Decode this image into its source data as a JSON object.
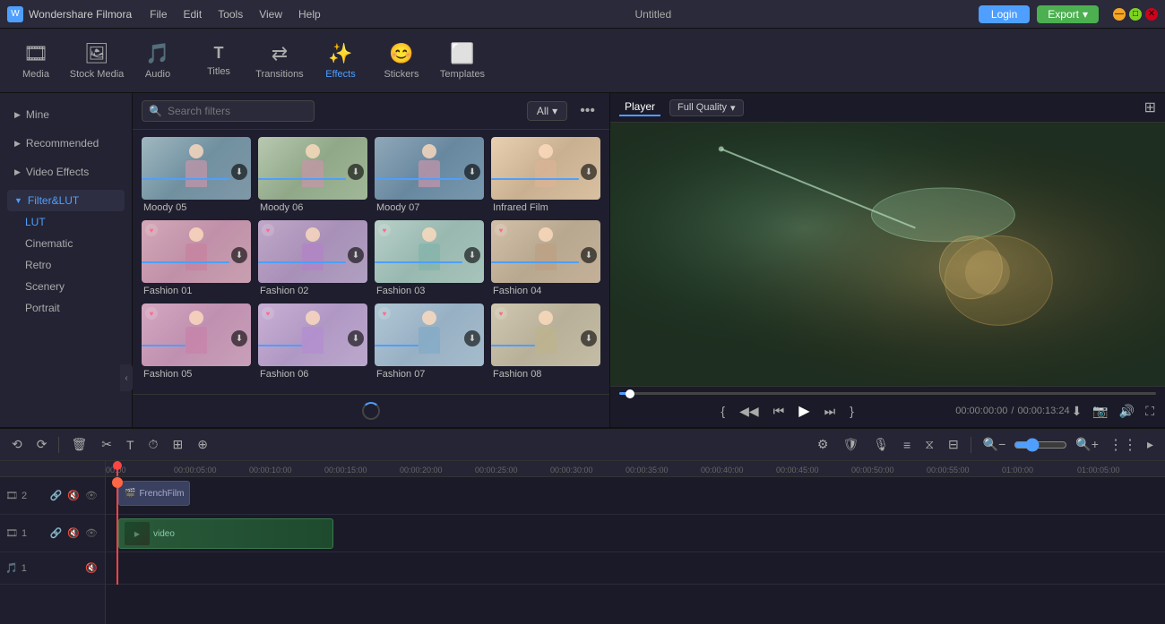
{
  "titlebar": {
    "app_name": "Wondershare Filmora",
    "logo_text": "W",
    "menus": [
      "File",
      "Edit",
      "Tools",
      "View",
      "Help"
    ],
    "title": "Untitled",
    "login_label": "Login",
    "export_label": "Export"
  },
  "toolbar": {
    "items": [
      {
        "id": "media",
        "label": "Media",
        "icon": "🎞"
      },
      {
        "id": "stock-media",
        "label": "Stock Media",
        "icon": "🖼"
      },
      {
        "id": "audio",
        "label": "Audio",
        "icon": "🎵"
      },
      {
        "id": "titles",
        "label": "Titles",
        "icon": "T"
      },
      {
        "id": "transitions",
        "label": "Transitions",
        "icon": "↔"
      },
      {
        "id": "effects",
        "label": "Effects",
        "icon": "✨"
      },
      {
        "id": "stickers",
        "label": "Stickers",
        "icon": "😊"
      },
      {
        "id": "templates",
        "label": "Templates",
        "icon": "⬜"
      }
    ]
  },
  "sidebar": {
    "sections": [
      {
        "id": "mine",
        "label": "Mine",
        "expanded": false
      },
      {
        "id": "recommended",
        "label": "Recommended",
        "expanded": false
      },
      {
        "id": "video-effects",
        "label": "Video Effects",
        "expanded": false
      },
      {
        "id": "filter-lut",
        "label": "Filter&LUT",
        "expanded": true
      }
    ],
    "subsections": [
      {
        "id": "lut",
        "label": "LUT",
        "active": true
      },
      {
        "id": "cinematic",
        "label": "Cinematic"
      },
      {
        "id": "retro",
        "label": "Retro"
      },
      {
        "id": "scenery",
        "label": "Scenery"
      },
      {
        "id": "portrait",
        "label": "Portrait"
      }
    ]
  },
  "filter_panel": {
    "search_placeholder": "Search filters",
    "all_label": "All",
    "filters": [
      {
        "id": "moody05",
        "label": "Moody 05",
        "thumb_class": "moody05",
        "has_download": true,
        "has_heart": false,
        "progress": 80
      },
      {
        "id": "moody06",
        "label": "Moody 06",
        "thumb_class": "moody06",
        "has_download": true,
        "has_heart": false,
        "progress": 80
      },
      {
        "id": "moody07",
        "label": "Moody 07",
        "thumb_class": "moody07",
        "has_download": true,
        "has_heart": false,
        "progress": 80
      },
      {
        "id": "infrared",
        "label": "Infrared Film",
        "thumb_class": "infrared",
        "has_download": true,
        "has_heart": false,
        "progress": 80
      },
      {
        "id": "fashion01",
        "label": "Fashion 01",
        "thumb_class": "fashion01",
        "has_download": true,
        "has_heart": true,
        "progress": 80
      },
      {
        "id": "fashion02",
        "label": "Fashion 02",
        "thumb_class": "fashion02",
        "has_download": true,
        "has_heart": true,
        "progress": 80
      },
      {
        "id": "fashion03",
        "label": "Fashion 03",
        "thumb_class": "fashion03",
        "has_download": true,
        "has_heart": true,
        "progress": 80
      },
      {
        "id": "fashion04",
        "label": "Fashion 04",
        "thumb_class": "fashion04",
        "has_download": true,
        "has_heart": true,
        "progress": 80
      },
      {
        "id": "fashion05",
        "label": "Fashion 05",
        "thumb_class": "fashion05",
        "has_download": true,
        "has_heart": true,
        "progress": 40
      },
      {
        "id": "fashion06",
        "label": "Fashion 06",
        "thumb_class": "fashion06",
        "has_download": true,
        "has_heart": true,
        "progress": 40
      },
      {
        "id": "fashion07",
        "label": "Fashion 07",
        "thumb_class": "fashion07",
        "has_download": true,
        "has_heart": true,
        "progress": 40
      },
      {
        "id": "fashion08",
        "label": "Fashion 08",
        "thumb_class": "fashion08",
        "has_download": true,
        "has_heart": true,
        "progress": 40
      }
    ]
  },
  "player": {
    "tab_label": "Player",
    "quality_label": "Full Quality",
    "time_current": "00:00:00:00",
    "time_separator": "/",
    "time_total": "00:00:13:24"
  },
  "timeline": {
    "ruler_marks": [
      "00:00",
      "00:00:05:00",
      "00:00:10:00",
      "00:00:15:00",
      "00:00:20:00",
      "00:00:25:00",
      "00:00:30:00",
      "00:00:35:00",
      "00:00:40:00",
      "00:00:45:00",
      "00:00:50:00",
      "00:00:55:00",
      "01:00:00",
      "01:00:05:00"
    ],
    "tracks": [
      {
        "id": "track1",
        "type": "effect",
        "number": 2,
        "clip_label": "FrenchFilm"
      },
      {
        "id": "track2",
        "type": "video",
        "number": 1,
        "clip_label": "video"
      },
      {
        "id": "track3",
        "type": "audio",
        "number": 1
      }
    ]
  }
}
